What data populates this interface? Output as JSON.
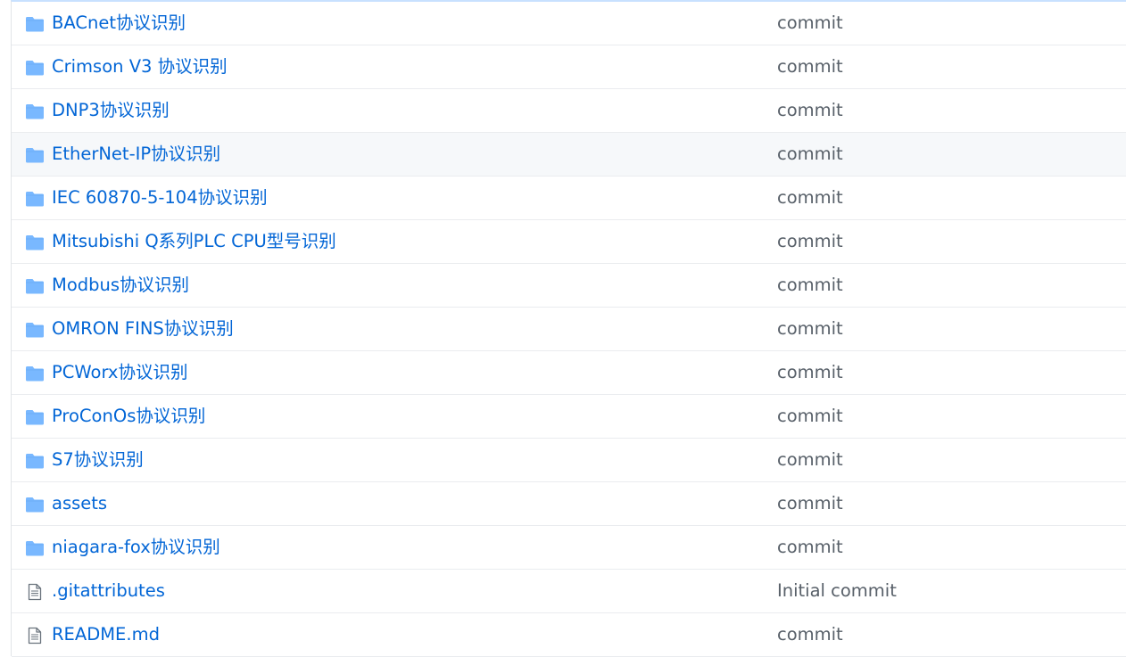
{
  "files": [
    {
      "name": "BACnet协议识别",
      "type": "folder",
      "icon": "folder-icon",
      "message": "commit"
    },
    {
      "name": "Crimson V3 协议识别",
      "type": "folder",
      "icon": "folder-icon",
      "message": "commit"
    },
    {
      "name": "DNP3协议识别",
      "type": "folder",
      "icon": "folder-icon",
      "message": "commit"
    },
    {
      "name": "EtherNet-IP协议识别",
      "type": "folder",
      "icon": "folder-icon",
      "message": "commit"
    },
    {
      "name": "IEC 60870-5-104协议识别",
      "type": "folder",
      "icon": "folder-icon",
      "message": "commit"
    },
    {
      "name": "Mitsubishi Q系列PLC CPU型号识别",
      "type": "folder",
      "icon": "folder-icon",
      "message": "commit"
    },
    {
      "name": "Modbus协议识别",
      "type": "folder",
      "icon": "folder-icon",
      "message": "commit"
    },
    {
      "name": "OMRON FINS协议识别",
      "type": "folder",
      "icon": "folder-icon",
      "message": "commit"
    },
    {
      "name": "PCWorx协议识别",
      "type": "folder",
      "icon": "folder-icon",
      "message": "commit"
    },
    {
      "name": "ProConOs协议识别",
      "type": "folder",
      "icon": "folder-icon",
      "message": "commit"
    },
    {
      "name": "S7协议识别",
      "type": "folder",
      "icon": "folder-icon",
      "message": "commit"
    },
    {
      "name": "assets",
      "type": "folder",
      "icon": "folder-icon",
      "message": "commit"
    },
    {
      "name": "niagara-fox协议识别",
      "type": "folder",
      "icon": "folder-icon",
      "message": "commit"
    },
    {
      "name": ".gitattributes",
      "type": "file",
      "icon": "file-icon",
      "message": "Initial commit"
    },
    {
      "name": "README.md",
      "type": "file",
      "icon": "file-icon",
      "message": "commit"
    }
  ],
  "hovered_row": 3,
  "colors": {
    "link": "#0366d6",
    "message": "#586069",
    "folder_icon": "#79b8ff",
    "file_icon": "#6a737d",
    "hover_background": "#f6f8fa"
  }
}
